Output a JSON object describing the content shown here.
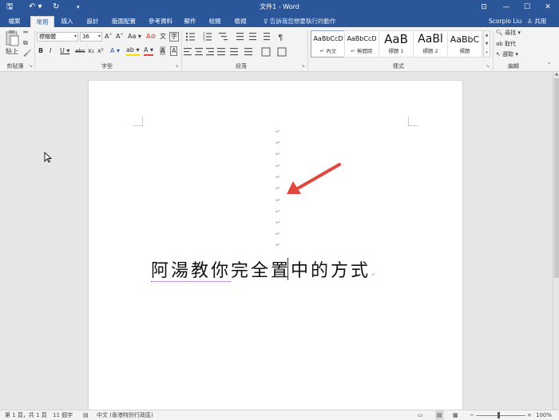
{
  "window": {
    "title": "文件1 - Word",
    "qat_save": "🖫",
    "qat_undo": "↶ ▾",
    "qat_redo": "↻",
    "qat_customize": "▾",
    "ribbon_display": "⊡",
    "minimize": "—",
    "maximize": "☐",
    "close": "✕"
  },
  "tabs": [
    {
      "label": "檔案"
    },
    {
      "label": "常用"
    },
    {
      "label": "插入"
    },
    {
      "label": "設計"
    },
    {
      "label": "版面配置"
    },
    {
      "label": "參考資料"
    },
    {
      "label": "郵件"
    },
    {
      "label": "校閱"
    },
    {
      "label": "檢視"
    }
  ],
  "active_tab": "常用",
  "tell_me": "♀ 告訴我您想要執行的動作",
  "user": {
    "name": "Scorpio Liu",
    "share": "♙ 共用"
  },
  "ribbon": {
    "clipboard": {
      "paste": "貼上",
      "label": "剪貼簿"
    },
    "font": {
      "font_name": "標楷體",
      "font_size": "36",
      "grow": "A˄",
      "shrink": "A˅",
      "case": "Aa ▾",
      "clear": "A⊘",
      "phonetic": "文",
      "enclose": "字",
      "bold": "B",
      "italic": "I",
      "underline": "U ▾",
      "strike": "abc",
      "subscript": "x₂",
      "superscript": "x²",
      "effects": "A ▾",
      "highlight": "ab ▾",
      "font_color": "A ▾",
      "char_shading": "A",
      "char_border": "A",
      "label": "字型"
    },
    "paragraph": {
      "label": "段落"
    },
    "styles": {
      "items": [
        {
          "preview": "AaBbCcD",
          "name": "↵ 內文"
        },
        {
          "preview": "AaBbCcD",
          "name": "↵ 無間距"
        },
        {
          "preview": "AaB",
          "name": "標題 1"
        },
        {
          "preview": "AaBl",
          "name": "標題 2"
        },
        {
          "preview": "AaBbC",
          "name": "標題"
        }
      ],
      "label": "樣式"
    },
    "editing": {
      "find": "尋找 ▾",
      "replace": "取代",
      "select": "選取 ▾",
      "label": "編輯"
    }
  },
  "document": {
    "paragraph_mark": "↵",
    "heading_text_underlined": "阿湯教你",
    "heading_text_rest": "完全置中的方式",
    "heading_end_mark": "↵"
  },
  "status": {
    "page": "第 1 頁，共 1 頁",
    "words": "11 個字",
    "language": "中文 (香港特別行政區)",
    "zoom": "100%"
  },
  "colors": {
    "title_blue": "#2b579a",
    "annotation_arrow": "#e0483e"
  }
}
